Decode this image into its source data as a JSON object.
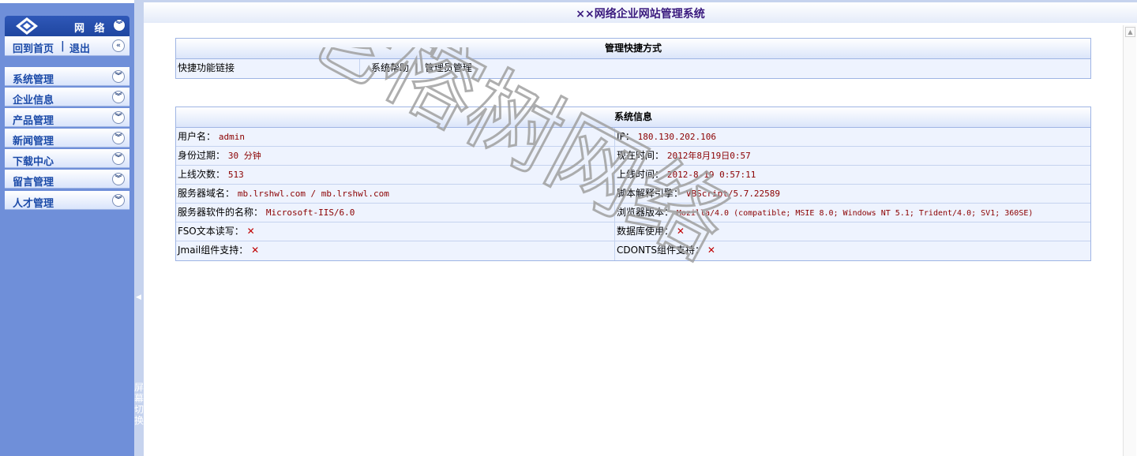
{
  "header": {
    "title": "××网络企业网站管理系统"
  },
  "sidebar": {
    "logo_text": "网 络",
    "home_link": "回到首页",
    "separator": "|",
    "logout_link": "退出",
    "items": [
      {
        "label": "系统管理"
      },
      {
        "label": "企业信息"
      },
      {
        "label": "产品管理"
      },
      {
        "label": "新闻管理"
      },
      {
        "label": "下载中心"
      },
      {
        "label": "留言管理"
      },
      {
        "label": "人才管理"
      }
    ]
  },
  "splitter": {
    "label": "屏幕切换"
  },
  "shortcuts": {
    "title": "管理快捷方式",
    "row_label": "快捷功能链接",
    "link_help": "系统帮助",
    "link_sep": "|",
    "link_admin": "管理员管理"
  },
  "sysinfo": {
    "title": "系统信息",
    "rows": [
      {
        "l_label": "用户名：",
        "l_value": "admin",
        "r_label": "IP：",
        "r_value": "180.130.202.106"
      },
      {
        "l_label": "身份过期：",
        "l_value": "30 分钟",
        "r_label": "现在时间：",
        "r_value": "2012年8月19日0:57"
      },
      {
        "l_label": "上线次数：",
        "l_value": "513",
        "r_label": "上线时间：",
        "r_value": "2012-8-19 0:57:11"
      },
      {
        "l_label": "服务器域名：",
        "l_value": "mb.lrshwl.com / mb.lrshwl.com",
        "r_label": "脚本解释引擎：",
        "r_value": "VBScript/5.7.22589"
      },
      {
        "l_label": "服务器软件的名称：",
        "l_value": "Microsoft-IIS/6.0",
        "r_label": "浏览器版本：",
        "r_value": "Mozilla/4.0 (compatible; MSIE 8.0; Windows NT 5.1; Trident/4.0; SV1; 360SE)"
      },
      {
        "l_label": "FSO文本读写：",
        "l_value": "✕",
        "r_label": "数据库使用：",
        "r_value": "✕"
      },
      {
        "l_label": "Jmail组件支持：",
        "l_value": "✕",
        "r_label": "CDONTS组件支持：",
        "r_value": "✕"
      }
    ]
  },
  "watermark": {
    "text": "老榕树网络"
  },
  "colors": {
    "sidebar": "#6f8fd9",
    "menu_text": "#1b4aa8",
    "title_text": "#3a1a7e",
    "value_text": "#8b0000"
  }
}
